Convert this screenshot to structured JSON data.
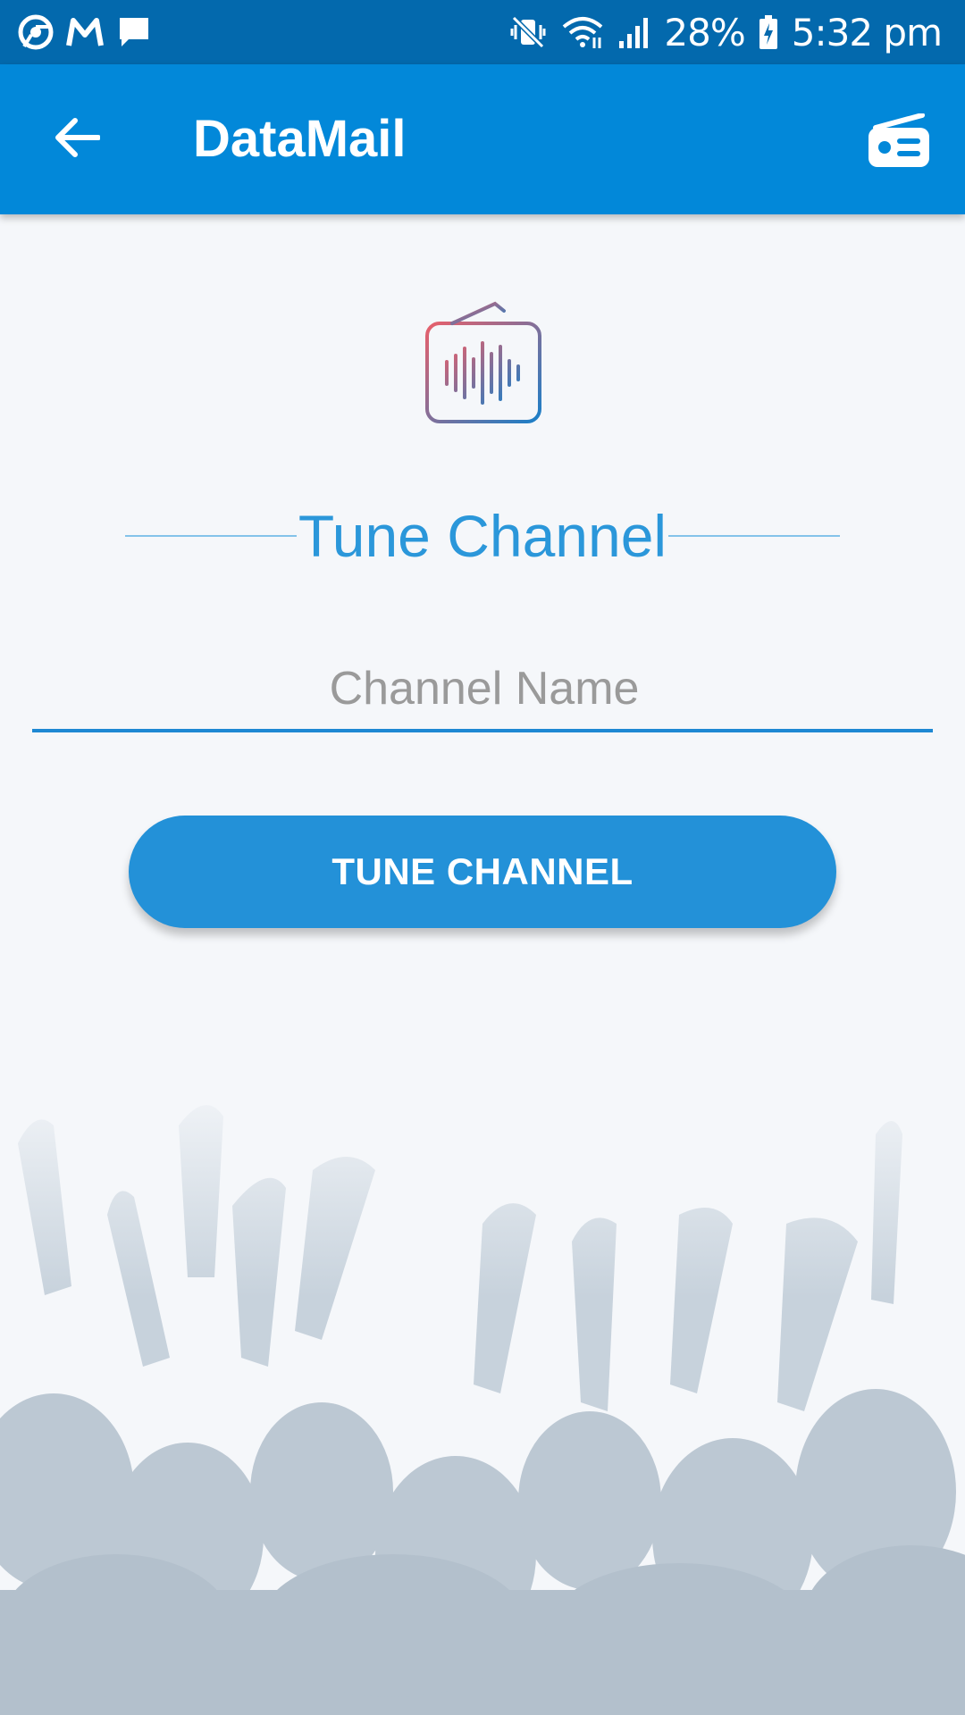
{
  "status_bar": {
    "battery": "28%",
    "time": "5:32 pm",
    "icons_left": [
      "chrome-icon",
      "gmail-icon",
      "message-icon"
    ],
    "icons_right": [
      "vibrate-icon",
      "wifi-icon",
      "signal-icon",
      "battery-icon"
    ]
  },
  "app_bar": {
    "title": "DataMail",
    "back_icon": "arrow-left-icon",
    "action_icon": "radio-icon",
    "color": "#0288d9"
  },
  "main": {
    "heading": "Tune Channel",
    "channel_input": {
      "value": "",
      "placeholder": "Channel Name"
    },
    "tune_button_label": "TUNE CHANNEL",
    "accent_color": "#2391d8",
    "wave_gradient": [
      "#e8606b",
      "#1a7fc8"
    ]
  }
}
